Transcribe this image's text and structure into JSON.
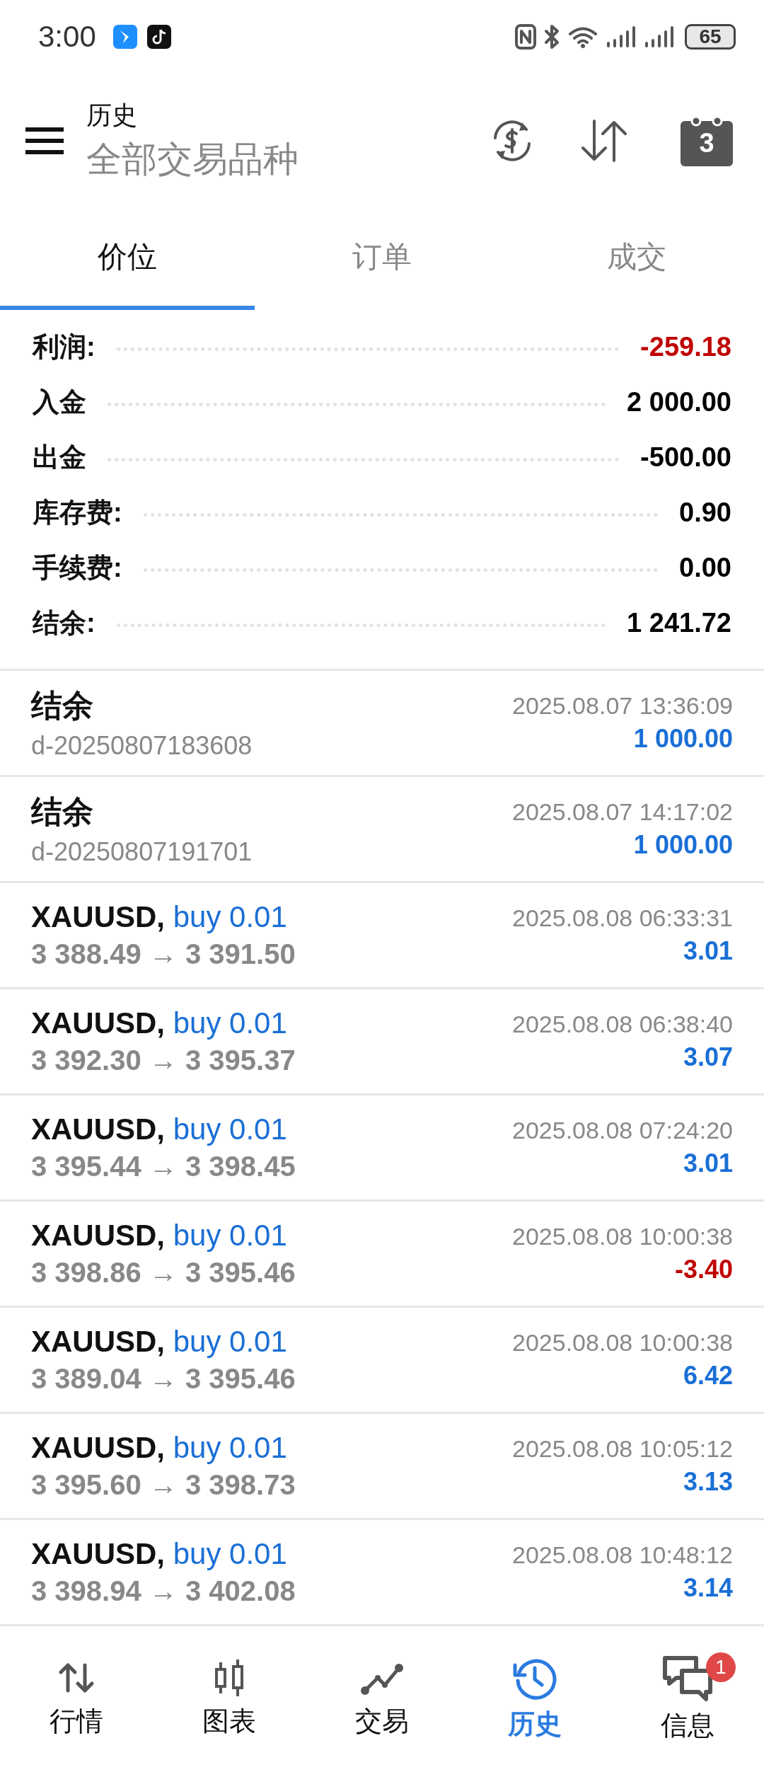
{
  "status_bar": {
    "time": "3:00",
    "battery": "65"
  },
  "header": {
    "title": "历史",
    "subtitle": "全部交易品种",
    "calendar_day": "3"
  },
  "tabs": [
    {
      "label": "价位",
      "selected": true
    },
    {
      "label": "订单",
      "selected": false
    },
    {
      "label": "成交",
      "selected": false
    }
  ],
  "summary": [
    {
      "label": "利润:",
      "value": "-259.18",
      "color": "#c00000"
    },
    {
      "label": "入金",
      "value": "2 000.00",
      "color": "#000000"
    },
    {
      "label": "出金",
      "value": "-500.00",
      "color": "#000000"
    },
    {
      "label": "库存费:",
      "value": "0.90",
      "color": "#000000"
    },
    {
      "label": "手续费:",
      "value": "0.00",
      "color": "#000000"
    },
    {
      "label": "结余:",
      "value": "1 241.72",
      "color": "#000000"
    }
  ],
  "deals": [
    {
      "kind": "balance",
      "title": "结余",
      "comment": "d-20250807183608",
      "time": "2025.08.07 13:36:09",
      "amount": "1 000.00",
      "color": "#1a6fd6"
    },
    {
      "kind": "balance",
      "title": "结余",
      "comment": "d-20250807191701",
      "time": "2025.08.07 14:17:02",
      "amount": "1 000.00",
      "color": "#1a6fd6"
    },
    {
      "kind": "trade",
      "symbol": "XAUUSD,",
      "side": "buy 0.01",
      "prices": "3 388.49 → 3 391.50",
      "time": "2025.08.08 06:33:31",
      "amount": "3.01",
      "color": "#1a6fd6"
    },
    {
      "kind": "trade",
      "symbol": "XAUUSD,",
      "side": "buy 0.01",
      "prices": "3 392.30 → 3 395.37",
      "time": "2025.08.08 06:38:40",
      "amount": "3.07",
      "color": "#1a6fd6"
    },
    {
      "kind": "trade",
      "symbol": "XAUUSD,",
      "side": "buy 0.01",
      "prices": "3 395.44 → 3 398.45",
      "time": "2025.08.08 07:24:20",
      "amount": "3.01",
      "color": "#1a6fd6"
    },
    {
      "kind": "trade",
      "symbol": "XAUUSD,",
      "side": "buy 0.01",
      "prices": "3 398.86 → 3 395.46",
      "time": "2025.08.08 10:00:38",
      "amount": "-3.40",
      "color": "#c00000"
    },
    {
      "kind": "trade",
      "symbol": "XAUUSD,",
      "side": "buy 0.01",
      "prices": "3 389.04 → 3 395.46",
      "time": "2025.08.08 10:00:38",
      "amount": "6.42",
      "color": "#1a6fd6"
    },
    {
      "kind": "trade",
      "symbol": "XAUUSD,",
      "side": "buy 0.01",
      "prices": "3 395.60 → 3 398.73",
      "time": "2025.08.08 10:05:12",
      "amount": "3.13",
      "color": "#1a6fd6"
    },
    {
      "kind": "trade",
      "symbol": "XAUUSD,",
      "side": "buy 0.01",
      "prices": "3 398.94 → 3 402.08",
      "time": "2025.08.08 10:48:12",
      "amount": "3.14",
      "color": "#1a6fd6"
    }
  ],
  "bottom_nav": [
    {
      "kind": "quotes",
      "label": "行情",
      "selected": false
    },
    {
      "kind": "chart",
      "label": "图表",
      "selected": false
    },
    {
      "kind": "trade",
      "label": "交易",
      "selected": false
    },
    {
      "kind": "history",
      "label": "历史",
      "selected": true
    },
    {
      "kind": "messages",
      "label": "信息",
      "selected": false,
      "badge": "1"
    }
  ]
}
